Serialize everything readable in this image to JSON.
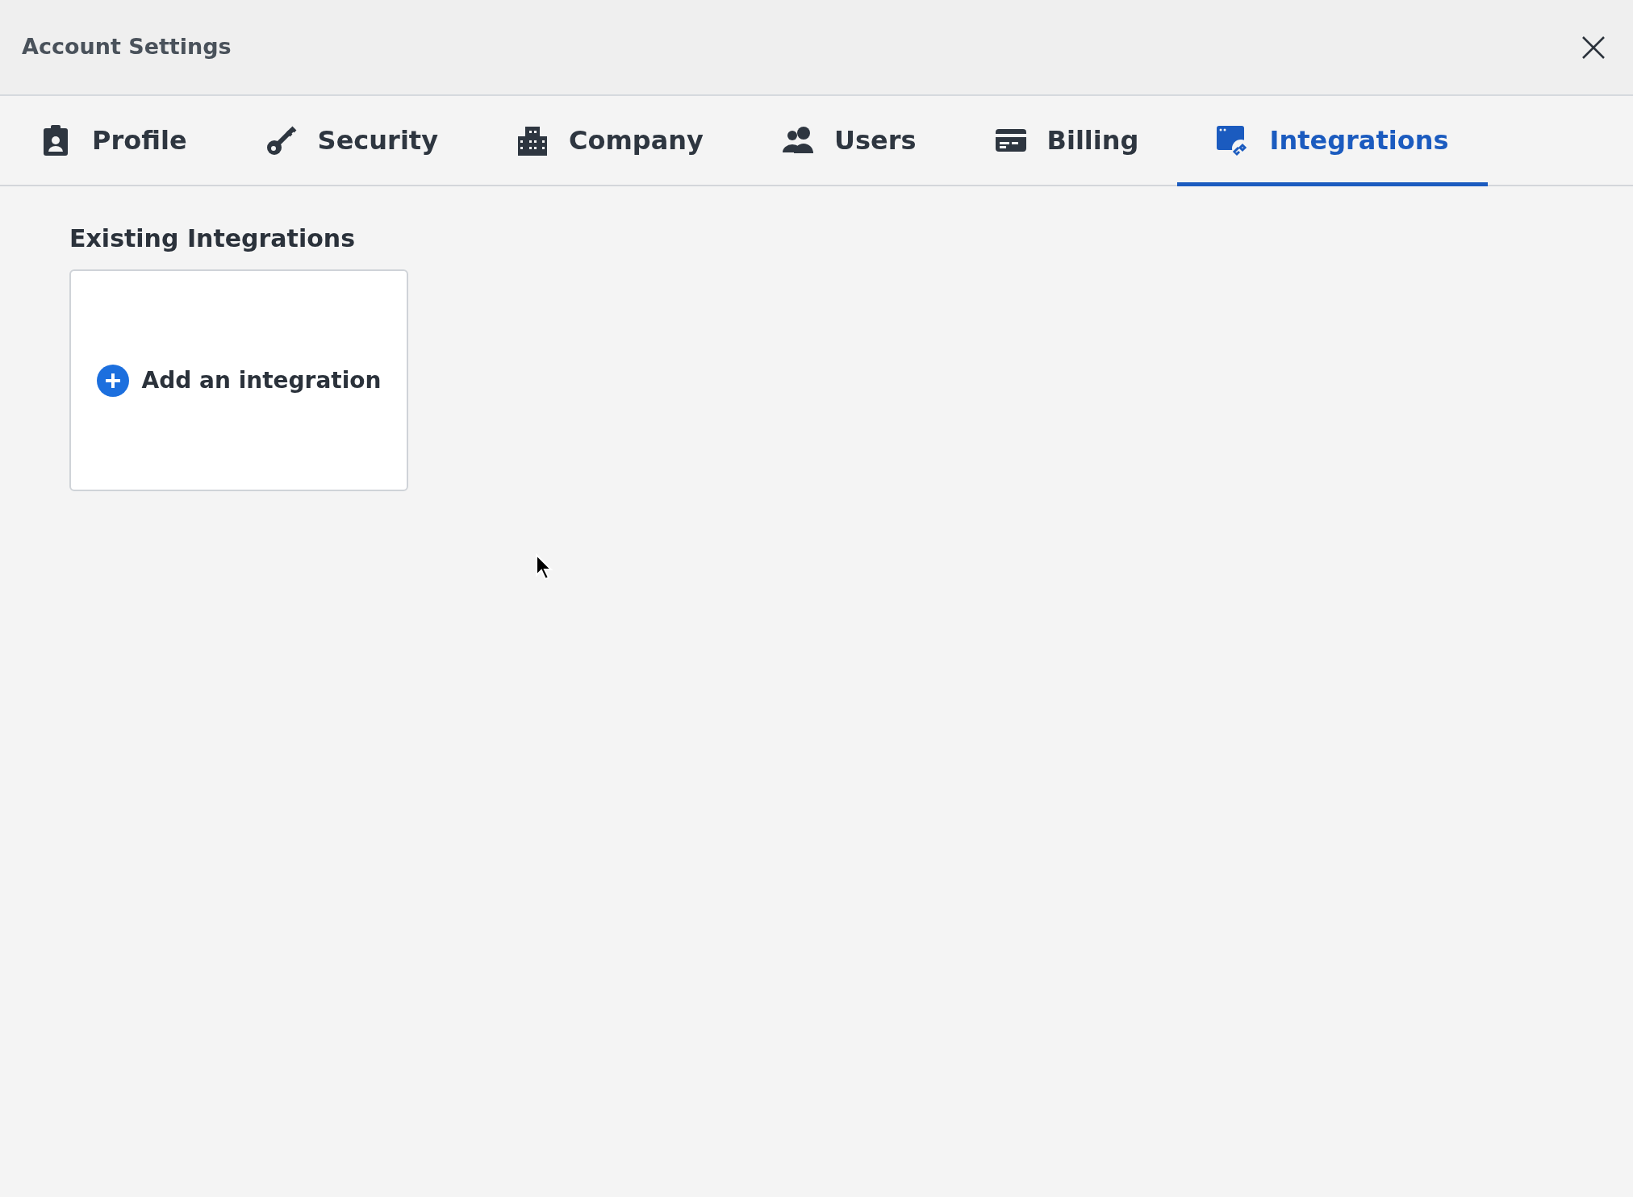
{
  "window": {
    "title": "Account Settings"
  },
  "tabs": [
    {
      "label": "Profile",
      "selected": false
    },
    {
      "label": "Security",
      "selected": false
    },
    {
      "label": "Company",
      "selected": false
    },
    {
      "label": "Users",
      "selected": false
    },
    {
      "label": "Billing",
      "selected": false
    },
    {
      "label": "Integrations",
      "selected": true
    }
  ],
  "section": {
    "heading": "Existing Integrations",
    "add_card": {
      "label": "Add an integration"
    }
  }
}
